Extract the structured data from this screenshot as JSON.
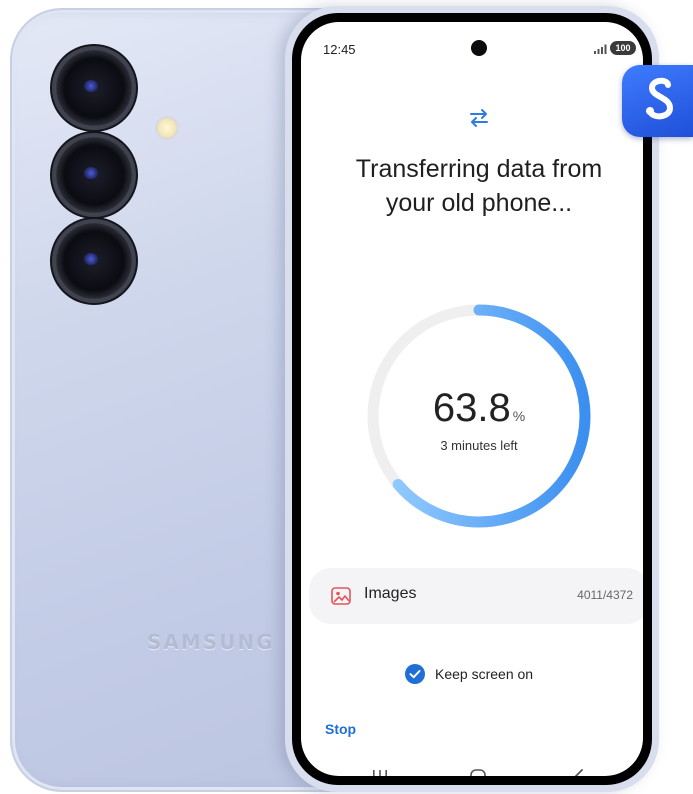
{
  "phone_back": {
    "brand": "SAMSUNG"
  },
  "status_bar": {
    "time": "12:45",
    "battery": "100"
  },
  "transfer": {
    "title_line1": "Transferring data from",
    "title_line2": "your old phone...",
    "progress_percent": 63.8,
    "percent_value": "63.8",
    "percent_sign": "%",
    "time_left": "3 minutes left"
  },
  "current_item": {
    "label": "Images",
    "count": "4011/4372"
  },
  "keep_screen": {
    "label": "Keep screen on",
    "checked": true
  },
  "stop_label": "Stop",
  "colors": {
    "accent": "#1f6fd6",
    "ring_track": "#efefef",
    "ring_gradient": [
      "#9bd0ff",
      "#3b8ff0"
    ],
    "app_icon": "#2a5fe8"
  },
  "icons": [
    "transfer-arrows-icon",
    "image-icon",
    "checkmark-icon",
    "recents-icon",
    "home-icon",
    "back-icon",
    "smart-switch-app-icon",
    "signal-icon",
    "battery-icon"
  ]
}
